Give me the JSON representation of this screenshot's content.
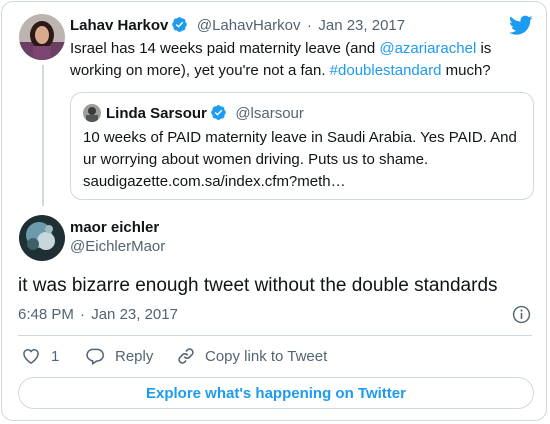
{
  "colors": {
    "accent": "#1d9bf0",
    "text": "#0f1419",
    "muted": "#536471",
    "border": "#cfd9de"
  },
  "parent_tweet": {
    "author_name": "Lahav Harkov",
    "author_handle": "@LahavHarkov",
    "separator": "·",
    "date": "Jan 23, 2017",
    "text_1": "Israel has 14 weeks paid maternity leave (and ",
    "mention": "@azariarachel",
    "text_2": " is working on more), yet you're not a fan. ",
    "hashtag": "#doublestandard",
    "text_3": " much?"
  },
  "quoted_tweet": {
    "author_name": "Linda Sarsour",
    "author_handle": "@lsarsour",
    "text": "10 weeks of PAID maternity leave in Saudi Arabia. Yes PAID. And ur worrying about women driving. Puts us to shame. saudigazette.com.sa/index.cfm?meth…"
  },
  "main_tweet": {
    "author_name": "maor eichler",
    "author_handle": "@EichlerMaor",
    "text": "it was bizarre enough tweet without the double standards",
    "time": "6:48 PM",
    "separator": "·",
    "date": "Jan 23, 2017"
  },
  "actions": {
    "like_count": "1",
    "reply_label": "Reply",
    "copy_link_label": "Copy link to Tweet"
  },
  "explore_label": "Explore what's happening on Twitter",
  "icons": [
    "twitter-bird-icon",
    "verified-badge-icon",
    "info-icon",
    "heart-icon",
    "reply-icon",
    "link-icon"
  ]
}
